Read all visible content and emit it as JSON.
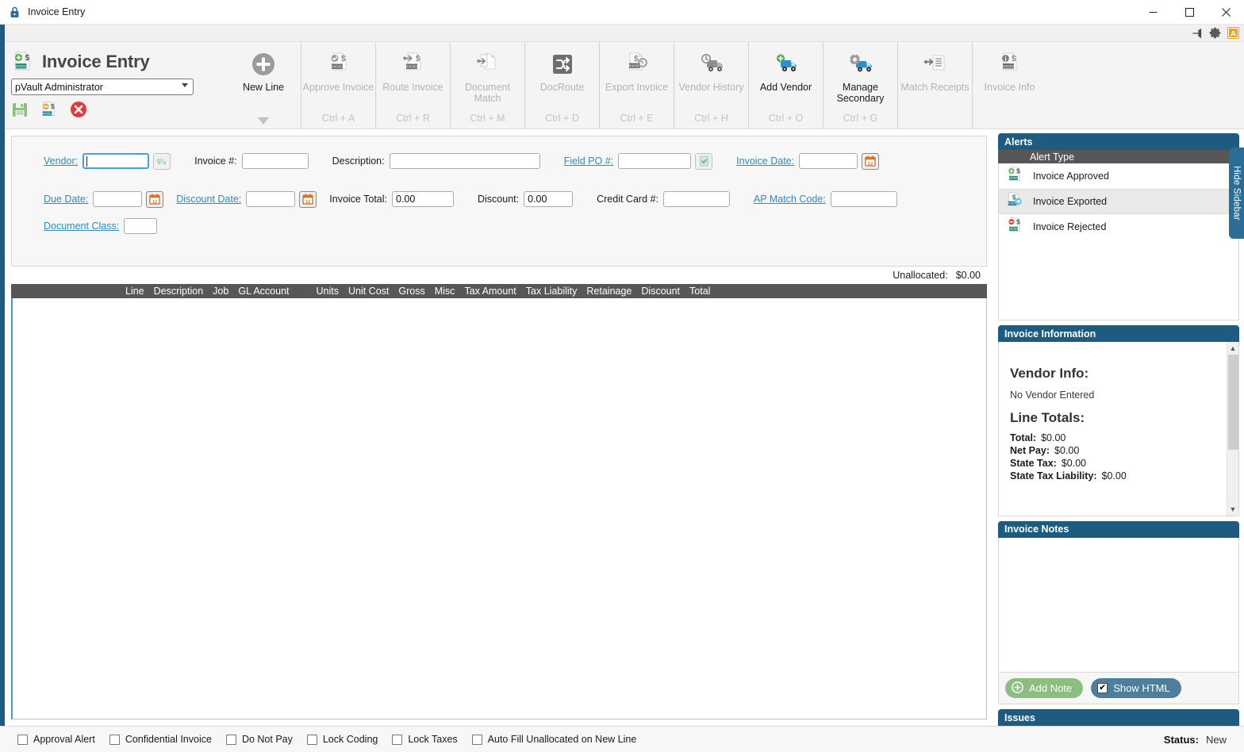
{
  "window": {
    "title": "Invoice Entry",
    "lock_icon": "lock-icon",
    "minimize": "–",
    "maximize": "□",
    "close": "✕"
  },
  "settings_strip": {
    "pin_icon": "pin-icon",
    "gear_icon": "gear-icon",
    "app_icon": "app-badge-icon"
  },
  "ribbon": {
    "app_title": "Invoice Entry",
    "app_icon": "invoice-add-icon",
    "user": "pVault Administrator",
    "quick_actions": [
      {
        "name": "save-icon",
        "label": "Save"
      },
      {
        "name": "pending-invoice-icon",
        "label": "Pending Invoice"
      },
      {
        "name": "cancel-icon",
        "label": "Cancel"
      }
    ],
    "items": [
      {
        "label": "New Line",
        "shortcut": "",
        "enabled": true,
        "icon": "plus-circle-icon",
        "has_caret": true
      },
      {
        "label": "Approve Invoice",
        "shortcut": "Ctrl + A",
        "enabled": false,
        "icon": "approve-invoice-icon",
        "has_caret": false
      },
      {
        "label": "Route Invoice",
        "shortcut": "Ctrl + R",
        "enabled": false,
        "icon": "route-invoice-icon",
        "has_caret": false
      },
      {
        "label": "Document Match",
        "shortcut": "Ctrl + M",
        "enabled": false,
        "icon": "document-match-icon",
        "has_caret": false
      },
      {
        "label": "DocRoute",
        "shortcut": "Ctrl + D",
        "enabled": false,
        "icon": "docroute-icon",
        "has_caret": false
      },
      {
        "label": "Export Invoice",
        "shortcut": "Ctrl + E",
        "enabled": false,
        "icon": "export-invoice-icon",
        "has_caret": false
      },
      {
        "label": "Vendor History",
        "shortcut": "Ctrl + H",
        "enabled": false,
        "icon": "vendor-history-icon",
        "has_caret": false
      },
      {
        "label": "Add Vendor",
        "shortcut": "Ctrl + O",
        "enabled": true,
        "icon": "add-vendor-icon",
        "has_caret": false
      },
      {
        "label": "Manage Secondary",
        "shortcut": "Ctrl + G",
        "enabled": true,
        "icon": "manage-secondary-icon",
        "has_caret": false
      },
      {
        "label": "Match Receipts",
        "shortcut": "",
        "enabled": false,
        "icon": "match-receipts-icon",
        "has_caret": false
      },
      {
        "label": "Invoice Info",
        "shortcut": "",
        "enabled": false,
        "icon": "invoice-info-icon",
        "has_caret": false
      }
    ]
  },
  "form": {
    "vendor_label": "Vendor:",
    "vendor_value": "",
    "vendor_lookup_icon": "vendor-truck-icon",
    "invoice_num_label": "Invoice #:",
    "invoice_num_value": "",
    "description_label": "Description:",
    "description_value": "",
    "field_po_label": "Field PO #:",
    "field_po_value": "",
    "field_po_icon": "po-check-icon",
    "invoice_date_label": "Invoice Date:",
    "invoice_date_value": "",
    "invoice_date_icon": "calendar-icon",
    "due_date_label": "Due Date:",
    "due_date_value": "",
    "due_date_icon": "calendar-icon",
    "discount_date_label": "Discount Date:",
    "discount_date_value": "",
    "discount_date_icon": "calendar-icon",
    "invoice_total_label": "Invoice Total:",
    "invoice_total_value": "0.00",
    "discount_label": "Discount:",
    "discount_value": "0.00",
    "credit_card_label": "Credit Card #:",
    "credit_card_value": "",
    "ap_match_code_label": "AP Match Code:",
    "ap_match_code_value": "",
    "document_class_label": "Document Class:",
    "document_class_value": ""
  },
  "unallocated": {
    "label": "Unallocated:",
    "value": "$0.00"
  },
  "grid": {
    "columns": [
      "Line",
      "Description",
      "Job",
      "GL Account",
      "Units",
      "Unit Cost",
      "Gross",
      "Misc",
      "Tax Amount",
      "Tax Liability",
      "Retainage",
      "Discount",
      "Total"
    ],
    "rows": []
  },
  "sidebar": {
    "hide_tab_label": "Hide Sidebar",
    "alerts": {
      "title": "Alerts",
      "column_header": "Alert Type",
      "rows": [
        {
          "label": "Invoice Approved",
          "icon": "invoice-approved-icon",
          "selected": false
        },
        {
          "label": "Invoice Exported",
          "icon": "invoice-exported-icon",
          "selected": true
        },
        {
          "label": "Invoice Rejected",
          "icon": "invoice-rejected-icon",
          "selected": false
        }
      ]
    },
    "invoice_information": {
      "title": "Invoice Information",
      "vendor_heading": "Vendor Info:",
      "vendor_text": "No Vendor Entered",
      "totals_heading": "Line Totals:",
      "totals": [
        {
          "label": "Total:",
          "value": "$0.00"
        },
        {
          "label": "Net Pay:",
          "value": "$0.00"
        },
        {
          "label": "State Tax:",
          "value": "$0.00"
        },
        {
          "label": "State Tax Liability:",
          "value": "$0.00"
        }
      ]
    },
    "invoice_notes": {
      "title": "Invoice Notes",
      "add_note_label": "Add Note",
      "add_note_icon": "plus-circle-icon",
      "show_html_label": "Show HTML",
      "show_html_checked": true,
      "content": ""
    },
    "issues": {
      "title": "Issues"
    }
  },
  "statusbar": {
    "checkboxes": [
      {
        "label": "Approval Alert",
        "checked": false
      },
      {
        "label": "Confidential Invoice",
        "checked": false
      },
      {
        "label": "Do Not Pay",
        "checked": false
      },
      {
        "label": "Lock Coding",
        "checked": false
      },
      {
        "label": "Lock Taxes",
        "checked": false
      },
      {
        "label": "Auto Fill Unallocated on New Line",
        "checked": false
      }
    ],
    "status_label": "Status:",
    "status_value": "New"
  },
  "colors": {
    "panel_header": "#1d5b80",
    "grid_header": "#575757",
    "accent_link": "#2a8dc4",
    "green_pill": "#8cbf7f",
    "blue_pill": "#4d7e9c",
    "disabled_text": "#b4b4b4"
  }
}
